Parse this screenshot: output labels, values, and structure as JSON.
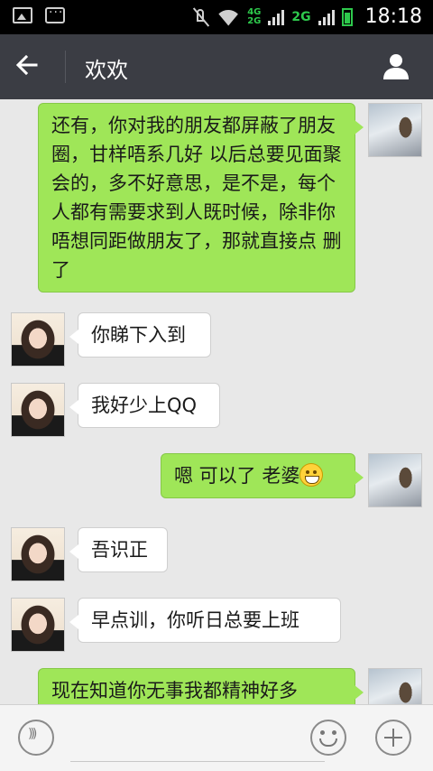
{
  "status_bar": {
    "time": "18:18",
    "network_primary": "4G\n2G",
    "network_secondary": "2G"
  },
  "header": {
    "title": "欢欢",
    "back_icon": "arrow-left-icon",
    "profile_icon": "person-icon"
  },
  "messages": [
    {
      "from": "me",
      "text": "还有，你对我的朋友都屏蔽了朋友圈，甘样唔系几好 以后总要见面聚会的，多不好意思，是不是，每个人都有需要求到人既时候，除非你唔想同距做朋友了，那就直接点 删了"
    },
    {
      "from": "her",
      "text": "你睇下入到"
    },
    {
      "from": "her",
      "text": "我好少上QQ"
    },
    {
      "from": "me",
      "text": "嗯 可以了 老婆",
      "emoji": "grinning-emoji"
    },
    {
      "from": "her",
      "text": "吾识正"
    },
    {
      "from": "her",
      "text": "早点训，你听日总要上班"
    },
    {
      "from": "me",
      "text": "现在知道你无事我都精神好多"
    }
  ],
  "input_bar": {
    "voice_icon": "voice-icon",
    "emoji_icon": "emoji-icon",
    "plus_icon": "plus-icon"
  }
}
